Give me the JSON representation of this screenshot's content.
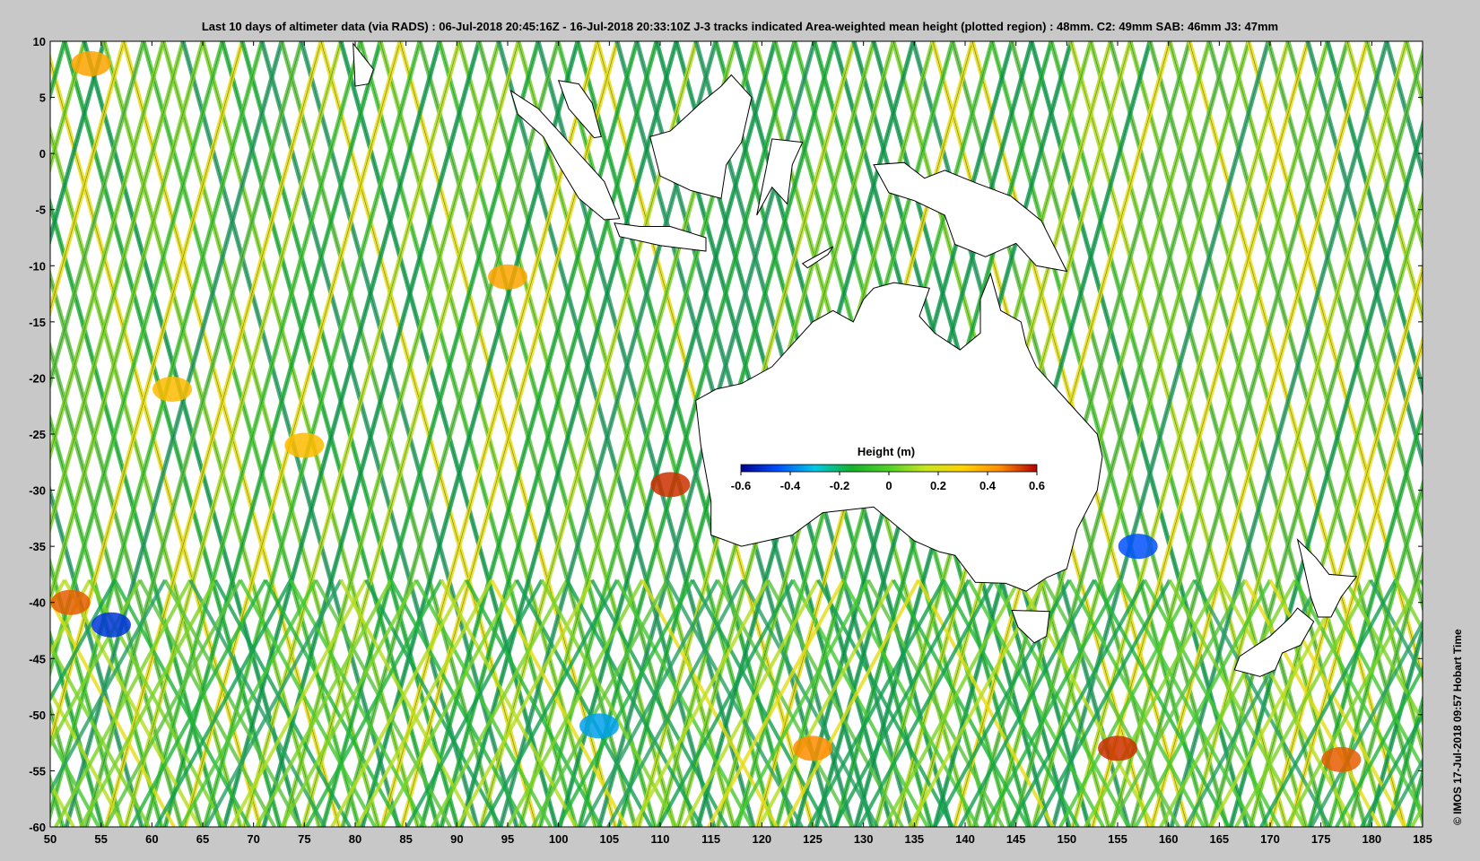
{
  "title": "Last 10 days of altimeter data (via RADS) : 06-Jul-2018 20:45:16Z - 16-Jul-2018 20:33:10Z  J-3 tracks indicated  Area-weighted mean height (plotted region) : 48mm.  C2: 49mm  SAB: 46mm  J3: 47mm",
  "credit": "© IMOS 17-Jul-2018 09:57 Hobart Time",
  "colorbar": {
    "title": "Height (m)",
    "range": [
      -0.6,
      0.6
    ],
    "ticks": [
      "-0.6",
      "-0.4",
      "-0.2",
      "0",
      "0.2",
      "0.4",
      "0.6"
    ],
    "colors": [
      "#00008f",
      "#0050ff",
      "#00c8e6",
      "#14b428",
      "#50d228",
      "#c8e61e",
      "#ffd200",
      "#ff8c00",
      "#b40000"
    ]
  },
  "chart_data": {
    "type": "map",
    "x_range": [
      50,
      185
    ],
    "y_range": [
      -60,
      10
    ],
    "x_ticks": [
      "50",
      "55",
      "60",
      "65",
      "70",
      "75",
      "80",
      "85",
      "90",
      "95",
      "100",
      "105",
      "110",
      "115",
      "120",
      "125",
      "130",
      "135",
      "140",
      "145",
      "150",
      "155",
      "160",
      "165",
      "170",
      "175",
      "180",
      "185"
    ],
    "y_ticks": [
      "10",
      "5",
      "0",
      "-5",
      "-10",
      "-15",
      "-20",
      "-25",
      "-30",
      "-35",
      "-40",
      "-45",
      "-50",
      "-55",
      "-60"
    ],
    "landmasses": [
      "Australia",
      "Tasmania",
      "New Zealand",
      "Sumatra",
      "Borneo",
      "Java",
      "Sulawesi",
      "New Guinea"
    ],
    "hotspots": [
      {
        "lon": 54,
        "lat": 8,
        "value": 0.4
      },
      {
        "lon": 95,
        "lat": -11,
        "value": 0.4
      },
      {
        "lon": 62,
        "lat": -21,
        "value": 0.35
      },
      {
        "lon": 75,
        "lat": -26,
        "value": 0.35
      },
      {
        "lon": 111,
        "lat": -29.5,
        "value": 0.55
      },
      {
        "lon": 52,
        "lat": -40,
        "value": 0.5
      },
      {
        "lon": 157,
        "lat": -35,
        "value": -0.45
      },
      {
        "lon": 155,
        "lat": -53,
        "value": 0.55
      },
      {
        "lon": 177,
        "lat": -54,
        "value": 0.5
      },
      {
        "lon": 125,
        "lat": -53,
        "value": 0.45
      },
      {
        "lon": 56,
        "lat": -42,
        "value": -0.5
      },
      {
        "lon": 104,
        "lat": -51,
        "value": -0.35
      }
    ]
  }
}
